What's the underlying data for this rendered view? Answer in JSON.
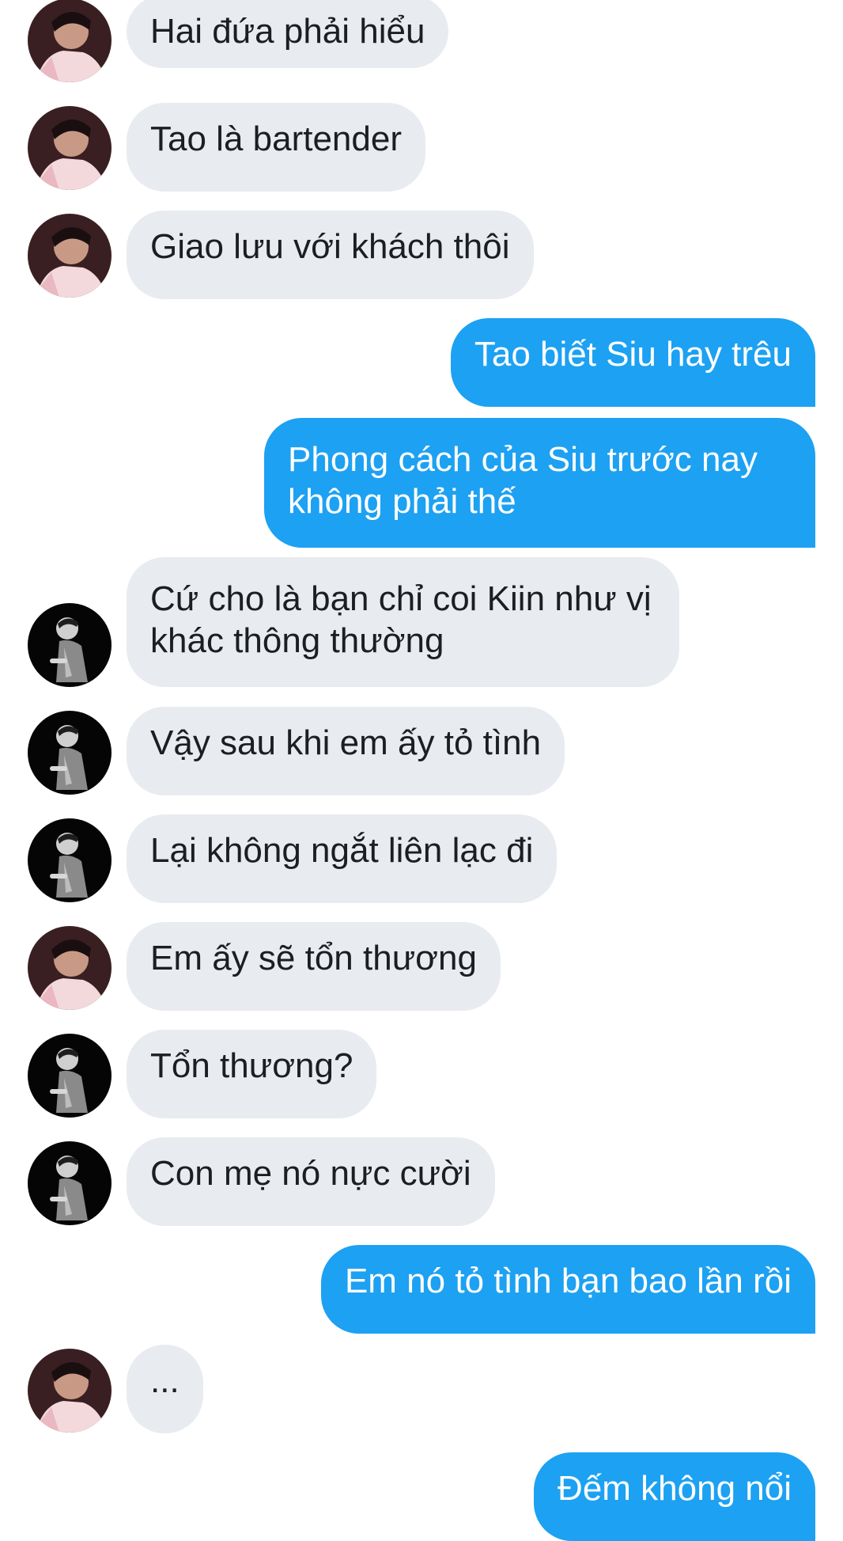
{
  "conversation": {
    "messages": [
      {
        "side": "in",
        "avatar": "pink-jacket",
        "text": "Hai đứa phải hiểu"
      },
      {
        "side": "in",
        "avatar": "pink-jacket",
        "text": "Tao là bartender"
      },
      {
        "side": "in",
        "avatar": "pink-jacket",
        "text": "Giao lưu với khách thôi"
      },
      {
        "side": "out",
        "text": "Tao biết Siu hay trêu"
      },
      {
        "side": "out",
        "text": "Phong cách của Siu trước nay không phải thế"
      },
      {
        "side": "in",
        "avatar": "dark-portrait",
        "text": "Cứ cho là bạn chỉ coi Kiin như vị khác thông thường"
      },
      {
        "side": "in",
        "avatar": "dark-portrait",
        "text": "Vậy sau khi em ấy tỏ tình"
      },
      {
        "side": "in",
        "avatar": "dark-portrait",
        "text": "Lại không ngắt liên lạc đi"
      },
      {
        "side": "in",
        "avatar": "pink-jacket",
        "text": "Em ấy sẽ tổn thương"
      },
      {
        "side": "in",
        "avatar": "dark-portrait",
        "text": "Tổn thương?"
      },
      {
        "side": "in",
        "avatar": "dark-portrait",
        "text": "Con mẹ nó nực cười"
      },
      {
        "side": "out",
        "text": "Em nó tỏ tình bạn bao lần rồi"
      },
      {
        "side": "in",
        "avatar": "pink-jacket",
        "text": "..."
      },
      {
        "side": "out",
        "text": "Đếm không nổi"
      }
    ]
  },
  "colors": {
    "incoming_bubble": "#e8ebef",
    "outgoing_bubble": "#1da1f2",
    "incoming_text": "#1c1e21",
    "outgoing_text": "#ffffff"
  }
}
